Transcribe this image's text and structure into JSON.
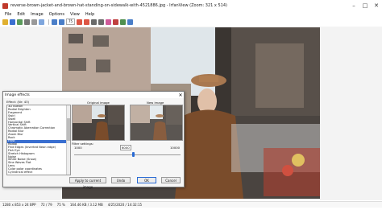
{
  "window": {
    "title": "reverse-brown-jacket-and-brown-hat-standing-on-sidewalk-with-4521886.jpg - IrfanView (Zoom: 321 x 514)",
    "controls": [
      "–",
      "□",
      "✕"
    ]
  },
  "menu": [
    "File",
    "Edit",
    "Image",
    "Options",
    "View",
    "Help"
  ],
  "toolbar": {
    "zoom_value": "75"
  },
  "status": {
    "dims": "1280 x 853 x 24 BPP",
    "index": "72 / 79",
    "zoom": "75 %",
    "size": "164.46 KB / 3.12 MB",
    "date": "4/25/2020 / 14:32:15"
  },
  "dialog": {
    "title": "Image effects",
    "effects_header": "Effect: (Nr: 43)",
    "effects": [
      "3D Button",
      "Radial Brighten",
      "Fragment",
      "Swirl",
      "Swell",
      "Horizontal Shift",
      "Vertical Shift",
      "Chromatic Aberration Correction",
      "Radial Blur",
      "Zoom Blur",
      "Rock",
      "Frost",
      "Radial",
      "Find Edges (Inverted Neon edge)",
      "Fish Eye",
      "Stretch Histogram",
      "Noise",
      "White Noise (Snow)",
      "Sine Waves Flat",
      "Lens",
      "Color polar coordinates",
      "Cylindrical effect",
      "Shift colors",
      "Metallic Effect",
      "Metallic - Gold",
      "Metallic - Ice",
      "Sepia"
    ],
    "selected_effect": "Frost",
    "original_label": "Original image",
    "new_label": "New image",
    "filter_label": "Filter settings:",
    "filter_min": "1000",
    "filter_value": "6000",
    "filter_max": "10000",
    "slider_level": 0.56,
    "buttons": {
      "apply": "Apply to current image",
      "undo": "Undo",
      "ok": "OK",
      "cancel": "Cancel"
    }
  }
}
